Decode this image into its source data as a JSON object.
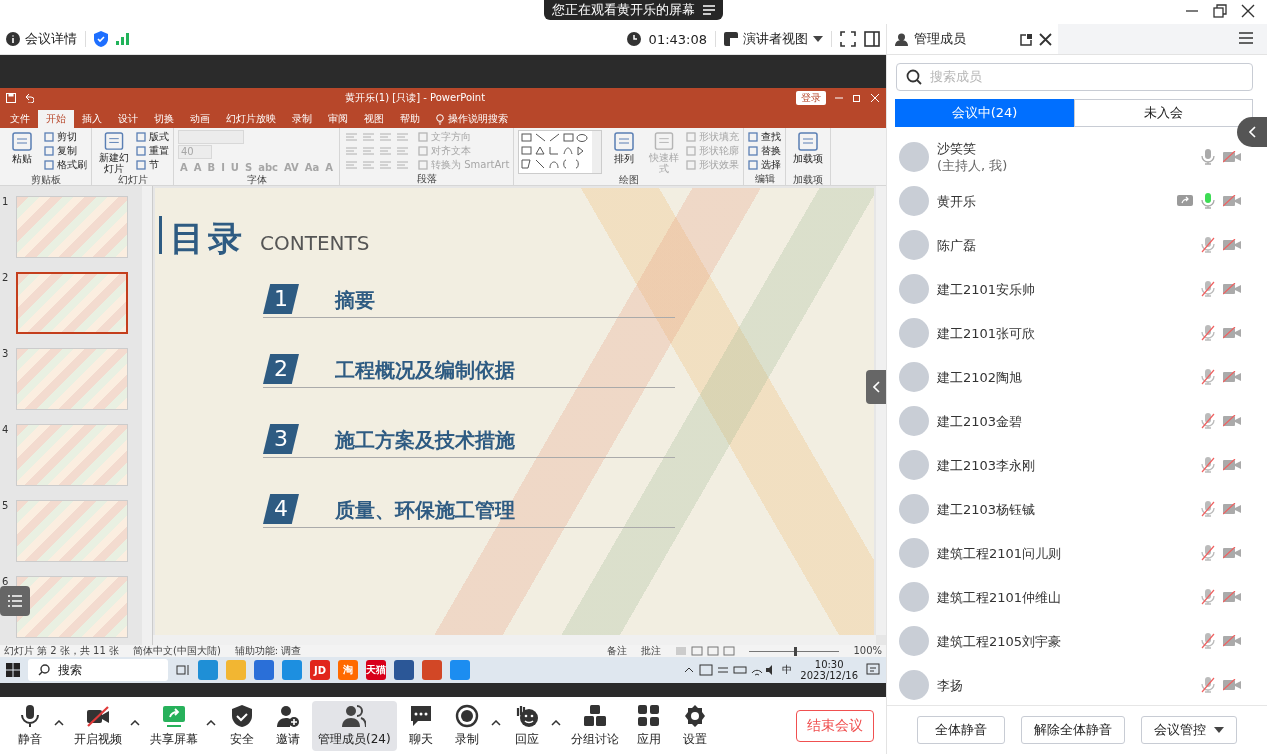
{
  "screen_notice": "您正在观看黄开乐的屏幕",
  "meeting_bar": {
    "info": "会议详情",
    "duration": "01:43:08",
    "view_mode": "演讲者视图"
  },
  "shared_screen": {
    "title": "黄开乐(1) [只读]  -  PowerPoint",
    "login": "登录",
    "tabs": [
      {
        "label": "文件",
        "selected": false
      },
      {
        "label": "开始",
        "selected": true
      },
      {
        "label": "插入",
        "selected": false
      },
      {
        "label": "设计",
        "selected": false
      },
      {
        "label": "切换",
        "selected": false
      },
      {
        "label": "动画",
        "selected": false
      },
      {
        "label": "幻灯片放映",
        "selected": false
      },
      {
        "label": "录制",
        "selected": false
      },
      {
        "label": "审阅",
        "selected": false
      },
      {
        "label": "视图",
        "selected": false
      },
      {
        "label": "帮助",
        "selected": false
      }
    ],
    "search_hint": "操作说明搜索",
    "ribbon": [
      {
        "label": "剪贴板",
        "commands": [
          {
            "kind": "large",
            "label": "粘贴",
            "disabled": false
          },
          {
            "kind": "small",
            "label": "剪切",
            "disabled": false
          },
          {
            "kind": "small",
            "label": "复制",
            "disabled": false
          },
          {
            "kind": "small",
            "label": "格式刷",
            "disabled": false
          }
        ]
      },
      {
        "label": "幻灯片",
        "commands": [
          {
            "kind": "large",
            "label": "新建幻灯片",
            "disabled": false
          },
          {
            "kind": "small",
            "label": "版式",
            "disabled": false
          },
          {
            "kind": "small",
            "label": "重置",
            "disabled": false
          },
          {
            "kind": "small",
            "label": "节",
            "disabled": false
          }
        ]
      },
      {
        "label": "字体",
        "commands": [
          {
            "kind": "field",
            "disabled": true
          },
          {
            "kind": "field",
            "value": "40",
            "disabled": true
          },
          {
            "kind": "glyph",
            "label": "A",
            "disabled": true
          },
          {
            "kind": "glyph",
            "label": "A",
            "disabled": true
          },
          {
            "kind": "glyph",
            "label": "B",
            "disabled": true
          },
          {
            "kind": "glyph",
            "label": "I",
            "disabled": true
          },
          {
            "kind": "glyph",
            "label": "U",
            "disabled": true
          },
          {
            "kind": "glyph",
            "label": "S",
            "disabled": true
          },
          {
            "kind": "glyph",
            "label": "abc",
            "disabled": true
          },
          {
            "kind": "glyph",
            "label": "AV",
            "disabled": true
          },
          {
            "kind": "glyph",
            "label": "Aa",
            "disabled": true
          },
          {
            "kind": "glyph",
            "label": "A",
            "disabled": true
          }
        ]
      },
      {
        "label": "段落",
        "commands": [
          {
            "kind": "tools"
          },
          {
            "kind": "small",
            "label": "文字方向",
            "disabled": true
          },
          {
            "kind": "small",
            "label": "对齐文本",
            "disabled": true
          },
          {
            "kind": "small",
            "label": "转换为 SmartArt",
            "disabled": true
          }
        ]
      },
      {
        "label": "绘图",
        "commands": [
          {
            "kind": "gallery"
          },
          {
            "kind": "large",
            "label": "排列",
            "disabled": false
          },
          {
            "kind": "large",
            "label": "快速样式",
            "disabled": true
          },
          {
            "kind": "small",
            "label": "形状填充",
            "disabled": true
          },
          {
            "kind": "small",
            "label": "形状轮廓",
            "disabled": true
          },
          {
            "kind": "small",
            "label": "形状效果",
            "disabled": true
          }
        ]
      },
      {
        "label": "编辑",
        "commands": [
          {
            "kind": "small",
            "label": "查找",
            "disabled": false
          },
          {
            "kind": "small",
            "label": "替换",
            "disabled": false
          },
          {
            "kind": "small",
            "label": "选择",
            "disabled": false
          }
        ]
      },
      {
        "label": "加载项",
        "commands": [
          {
            "kind": "large",
            "label": "加载项",
            "disabled": false
          }
        ]
      }
    ],
    "thumbnails": [
      {
        "number": "1",
        "selected": false
      },
      {
        "number": "2",
        "selected": true
      },
      {
        "number": "3",
        "selected": false
      },
      {
        "number": "4",
        "selected": false
      },
      {
        "number": "5",
        "selected": false
      },
      {
        "number": "6",
        "selected": false
      }
    ],
    "slide": {
      "title": "目录",
      "subtitle": "CONTENTS",
      "items": [
        {
          "number": "1",
          "text": "摘要"
        },
        {
          "number": "2",
          "text": "工程概况及编制依据"
        },
        {
          "number": "3",
          "text": "施工方案及技术措施"
        },
        {
          "number": "4",
          "text": "质量、环保施工管理"
        }
      ]
    },
    "status_bar": {
      "slide_count": "幻灯片 第 2 张，共 11 张",
      "language": "简体中文(中国大陆)",
      "accessibility": "辅助功能: 调查",
      "notes": "备注",
      "comments": "批注",
      "zoom": "100%",
      "level": 0.5
    },
    "taskbar": {
      "search": "搜索",
      "apps": [
        {
          "color": "#1f8fd6"
        },
        {
          "color": "#f2b632"
        },
        {
          "color": "#2a6fd8"
        },
        {
          "color": "#1d8fe0"
        },
        {
          "color": "#e1251b",
          "label": "JD"
        },
        {
          "color": "#ff6a00",
          "label": "淘"
        },
        {
          "color": "#d8001a",
          "label": "天猫"
        },
        {
          "color": "#2b5797"
        },
        {
          "color": "#d24726"
        },
        {
          "color": "#1c8df0"
        }
      ],
      "ime": "中",
      "time": "10:30",
      "date": "2023/12/16"
    }
  },
  "toolbar": {
    "items": [
      {
        "kind": "mic",
        "label": "静音",
        "menu": true,
        "selected": false
      },
      {
        "kind": "video",
        "label": "开启视频",
        "menu": true,
        "selected": false
      },
      {
        "kind": "share",
        "label": "共享屏幕",
        "menu": true,
        "selected": false
      },
      {
        "kind": "security",
        "label": "安全",
        "menu": false,
        "selected": false
      },
      {
        "kind": "invite",
        "label": "邀请",
        "menu": false,
        "selected": false
      },
      {
        "kind": "members",
        "label": "管理成员(24)",
        "menu": false,
        "selected": true
      },
      {
        "kind": "chat",
        "label": "聊天",
        "menu": false,
        "selected": false
      },
      {
        "kind": "record",
        "label": "录制",
        "menu": true,
        "selected": false
      },
      {
        "kind": "reaction",
        "label": "回应",
        "menu": true,
        "selected": false
      },
      {
        "kind": "breakout",
        "label": "分组讨论",
        "menu": false,
        "selected": false
      },
      {
        "kind": "apps",
        "label": "应用",
        "menu": false,
        "selected": false
      },
      {
        "kind": "settings",
        "label": "设置",
        "menu": false,
        "selected": false
      }
    ],
    "end_button": "结束会议"
  },
  "member_panel": {
    "title": "管理成员",
    "search_placeholder": "搜索成员",
    "tabs": [
      {
        "label": "会议中(24)",
        "selected": true
      },
      {
        "label": "未入会",
        "selected": false
      }
    ],
    "members": [
      {
        "name": "沙笑笑",
        "note": "(主持人, 我)",
        "sharing": false,
        "muted": false,
        "speaking": false,
        "video": false
      },
      {
        "name": "黄开乐",
        "sharing": true,
        "muted": false,
        "speaking": true,
        "video": false
      },
      {
        "name": "陈广磊",
        "sharing": false,
        "muted": true,
        "speaking": false,
        "video": false
      },
      {
        "name": "建工2101安乐帅",
        "sharing": false,
        "muted": true,
        "speaking": false,
        "video": false
      },
      {
        "name": "建工2101张可欣",
        "sharing": false,
        "muted": true,
        "speaking": false,
        "video": false
      },
      {
        "name": "建工2102陶旭",
        "sharing": false,
        "muted": true,
        "speaking": false,
        "video": false
      },
      {
        "name": "建工2103金碧",
        "sharing": false,
        "muted": true,
        "speaking": false,
        "video": false
      },
      {
        "name": "建工2103李永刚",
        "sharing": false,
        "muted": true,
        "speaking": false,
        "video": false
      },
      {
        "name": "建工2103杨钰铖",
        "sharing": false,
        "muted": true,
        "speaking": false,
        "video": false
      },
      {
        "name": "建筑工程2101问儿则",
        "sharing": false,
        "muted": true,
        "speaking": false,
        "video": false
      },
      {
        "name": "建筑工程2101仲维山",
        "sharing": false,
        "muted": true,
        "speaking": false,
        "video": false
      },
      {
        "name": "建筑工程2105刘宇豪",
        "sharing": false,
        "muted": true,
        "speaking": false,
        "video": false
      },
      {
        "name": "李扬",
        "sharing": false,
        "muted": true,
        "speaking": false,
        "video": false
      }
    ],
    "buttons": [
      {
        "label": "全体静音",
        "dropdown": false
      },
      {
        "label": "解除全体静音",
        "dropdown": false
      },
      {
        "label": "会议管控",
        "dropdown": true
      }
    ]
  }
}
